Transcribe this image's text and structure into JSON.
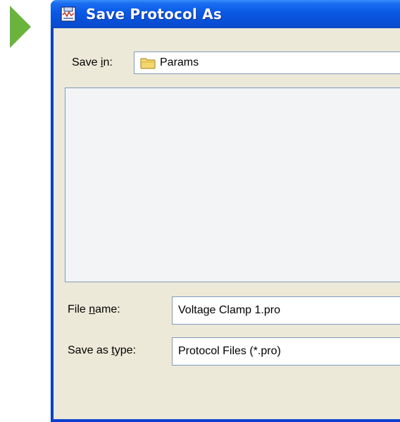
{
  "window": {
    "title": "Save Protocol As",
    "title_icon": "save-protocol-icon",
    "titlebar_color": "#0a58e4",
    "client_bg": "#ece9d8"
  },
  "decoration": {
    "arrow_icon": "play-arrow-icon",
    "arrow_color": "#6ab43e"
  },
  "save_in": {
    "label_prefix": "Save ",
    "label_accel": "i",
    "label_suffix": "n:",
    "value": "Params",
    "icon": "folder-icon"
  },
  "file_name": {
    "label_prefix": "File ",
    "label_accel": "n",
    "label_suffix": "ame:",
    "value": "Voltage Clamp 1.pro"
  },
  "save_as_type": {
    "label_prefix": "Save as ",
    "label_accel": "t",
    "label_suffix": "ype:",
    "value": "Protocol Files (*.pro)"
  }
}
